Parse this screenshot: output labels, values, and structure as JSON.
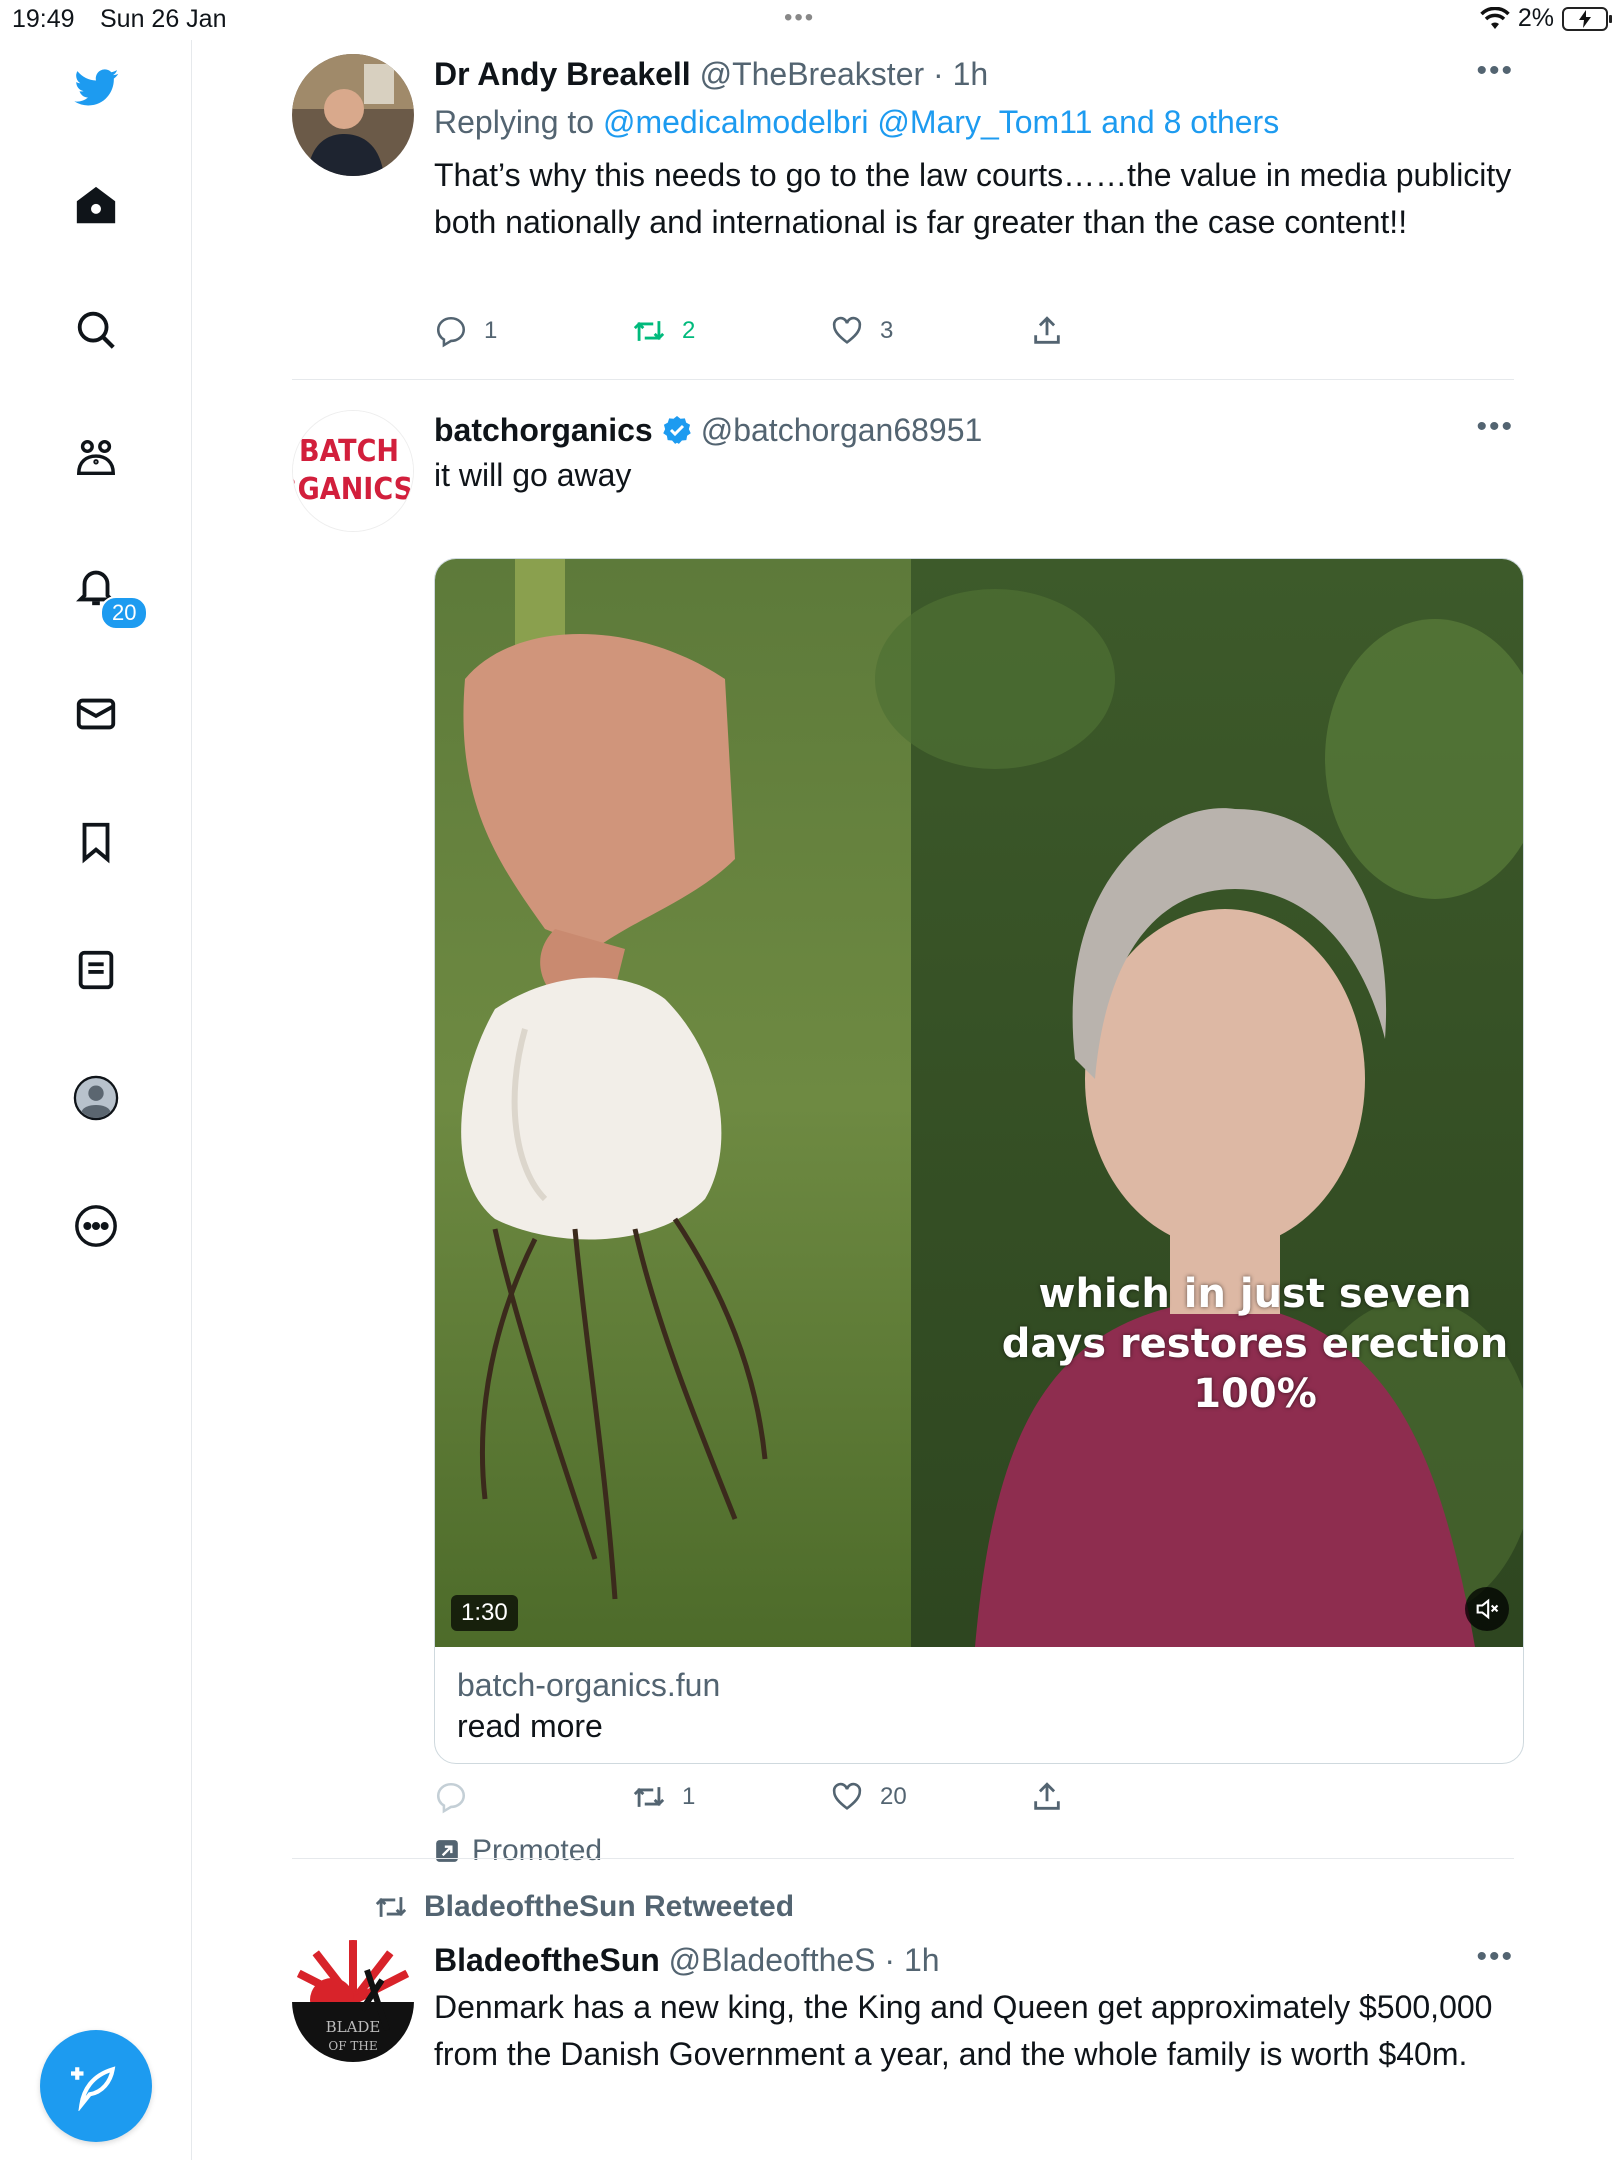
{
  "status_bar": {
    "time": "19:49",
    "date": "Sun 26 Jan",
    "battery": "2%"
  },
  "sidebar": {
    "notifications_badge": "20",
    "items": [
      "twitter-logo",
      "home-icon",
      "search-icon",
      "communities-icon",
      "notifications-icon",
      "messages-icon",
      "bookmarks-icon",
      "lists-icon",
      "profile-icon",
      "more-icon"
    ]
  },
  "tweets": [
    {
      "name": "Dr Andy Breakell",
      "handle": "@TheBreakster",
      "time": "· 1h",
      "more": "•••",
      "replying_prefix": "Replying to",
      "replying_to": "@medicalmodelbri @Mary_Tom11 and 8 others",
      "text": "That’s why this needs to go to the law courts……the value in media publicity both nationally and international is far greater than the case content!!",
      "replies": "1",
      "retweets": "2",
      "likes": "3"
    },
    {
      "name": "batchorganics",
      "handle": "@batchorgan68951",
      "more": "•••",
      "avatar_text_1": "BATCH",
      "avatar_text_2": "RGANICS",
      "text": "it will go away",
      "video_caption": "which in just seven days restores erection 100%",
      "video_duration": "1:30",
      "card_domain": "batch-organics.fun",
      "card_title": "read more",
      "replies": "",
      "retweets": "1",
      "likes": "20",
      "promoted": "Promoted"
    },
    {
      "retweeted_by": "BladeoftheSun Retweeted",
      "name": "BladeoftheSun",
      "handle": "@BladeoftheS",
      "time": "· 1h",
      "more": "•••",
      "avatar_text_1": "BLADE",
      "avatar_text_2": "OF THE",
      "text": "Denmark has a new king, the King and Queen get approximately $500,000 from the Danish Government a year, and the whole family is worth $40m."
    }
  ],
  "colors": {
    "accent": "#1d9bf0",
    "secondary_text": "#536471",
    "retweet_green": "#00ba7c",
    "brand_red": "#d21f3c",
    "shirt": "#8e2d4f"
  }
}
